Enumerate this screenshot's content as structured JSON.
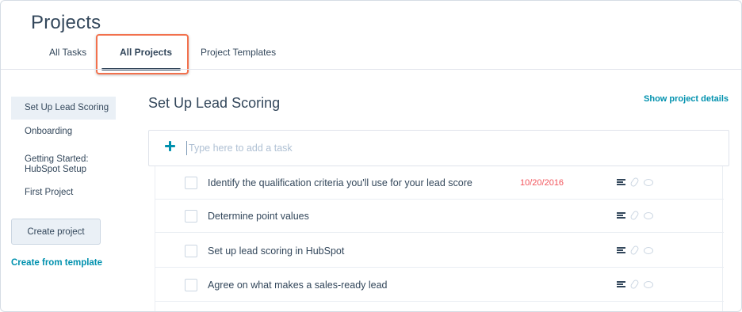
{
  "page": {
    "title": "Projects"
  },
  "tabs": [
    {
      "label": "All Tasks"
    },
    {
      "label": "All Projects"
    },
    {
      "label": "Project Templates"
    }
  ],
  "sidebar": {
    "items": [
      {
        "label": "Set Up Lead Scoring"
      },
      {
        "label": "Onboarding"
      },
      {
        "label": "Getting Started: HubSpot Setup"
      },
      {
        "label": "First Project"
      }
    ],
    "create_button": "Create project",
    "create_from_template": "Create from template"
  },
  "main": {
    "title": "Set Up Lead Scoring",
    "show_details": "Show project details",
    "add_task_placeholder": "Type here to add a task",
    "tasks": [
      {
        "text": "Identify the qualification criteria you'll use for your lead score",
        "date": "10/20/2016"
      },
      {
        "text": "Determine point values",
        "date": ""
      },
      {
        "text": "Set up lead scoring in HubSpot",
        "date": ""
      },
      {
        "text": "Agree on what makes a sales-ready lead",
        "date": ""
      }
    ]
  },
  "colors": {
    "accent": "#0091ae",
    "highlight": "#f2714d",
    "date": "#f2545b",
    "text": "#33475b"
  },
  "icons": {
    "add": "plus-icon",
    "note": "note-icon",
    "attachment": "paperclip-icon",
    "comment": "comment-icon"
  }
}
